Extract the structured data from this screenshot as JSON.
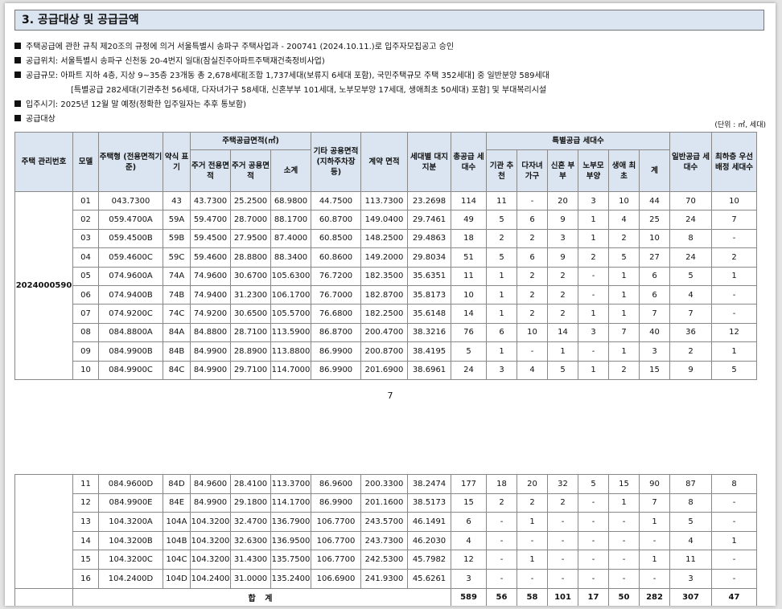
{
  "section_title": "3. 공급대상 및 공급금액",
  "bullets": [
    "주택공급에 관한 규칙 제20조의 규정에 의거 서울특별시 송파구 주택사업과 - 200741 (2024.10.11.)로 입주자모집공고 승인",
    "공급위치: 서울특별시 송파구 신천동 20-4번지 일대(잠실진주아파트주택재건축정비사업)",
    "공급규모: 아파트 지하 4층, 지상 9~35층 23개동 총 2,678세대[조합 1,737세대(보류지 6세대 포함), 국민주택규모 주택 352세대] 중 일반분양 589세대",
    "[특별공급 282세대(기관추천 56세대, 다자녀가구 58세대, 신혼부부 101세대, 노부모부양 17세대, 생애최초 50세대) 포함] 및 부대복리시설",
    "입주시기: 2025년 12월 말 예정(정확한 입주일자는 추후 통보함)",
    "공급대상"
  ],
  "unit_note": "(단위 : ㎡, 세대)",
  "headers": {
    "mgmt_no": "주택 관리번호",
    "model": "모델",
    "type": "주택형 (전용면적기준)",
    "abbr": "약식 표기",
    "supply_area": "주택공급면적(㎡)",
    "exclusive": "주거 전용면적",
    "common": "주거 공용면적",
    "subtotal": "소계",
    "other_common": "기타 공용면적 (지하주차장 등)",
    "contract_area": "계약 면적",
    "land_share": "세대별 대지지분",
    "total_units": "총공급 세대수",
    "special": "특별공급 세대수",
    "inst": "기관 추천",
    "multi": "다자녀 가구",
    "newlywed": "신혼 부부",
    "parents": "노부모 부양",
    "first": "생애 최초",
    "sum": "계",
    "general": "일반공급 세대수",
    "priority": "최하층 우선배정 세대수"
  },
  "management_code": "2024000590",
  "rows_page1": [
    [
      "01",
      "043.7300",
      "43",
      "43.7300",
      "25.2500",
      "68.9800",
      "44.7500",
      "113.7300",
      "23.2698",
      "114",
      "11",
      "-",
      "20",
      "3",
      "10",
      "44",
      "70",
      "10"
    ],
    [
      "02",
      "059.4700A",
      "59A",
      "59.4700",
      "28.7000",
      "88.1700",
      "60.8700",
      "149.0400",
      "29.7461",
      "49",
      "5",
      "6",
      "9",
      "1",
      "4",
      "25",
      "24",
      "7"
    ],
    [
      "03",
      "059.4500B",
      "59B",
      "59.4500",
      "27.9500",
      "87.4000",
      "60.8500",
      "148.2500",
      "29.4863",
      "18",
      "2",
      "2",
      "3",
      "1",
      "2",
      "10",
      "8",
      "-"
    ],
    [
      "04",
      "059.4600C",
      "59C",
      "59.4600",
      "28.8800",
      "88.3400",
      "60.8600",
      "149.2000",
      "29.8034",
      "51",
      "5",
      "6",
      "9",
      "2",
      "5",
      "27",
      "24",
      "2"
    ],
    [
      "05",
      "074.9600A",
      "74A",
      "74.9600",
      "30.6700",
      "105.6300",
      "76.7200",
      "182.3500",
      "35.6351",
      "11",
      "1",
      "2",
      "2",
      "-",
      "1",
      "6",
      "5",
      "1"
    ],
    [
      "06",
      "074.9400B",
      "74B",
      "74.9400",
      "31.2300",
      "106.1700",
      "76.7000",
      "182.8700",
      "35.8173",
      "10",
      "1",
      "2",
      "2",
      "-",
      "1",
      "6",
      "4",
      "-"
    ],
    [
      "07",
      "074.9200C",
      "74C",
      "74.9200",
      "30.6500",
      "105.5700",
      "76.6800",
      "182.2500",
      "35.6148",
      "14",
      "1",
      "2",
      "2",
      "1",
      "1",
      "7",
      "7",
      "-"
    ],
    [
      "08",
      "084.8800A",
      "84A",
      "84.8800",
      "28.7100",
      "113.5900",
      "86.8700",
      "200.4700",
      "38.3216",
      "76",
      "6",
      "10",
      "14",
      "3",
      "7",
      "40",
      "36",
      "12"
    ],
    [
      "09",
      "084.9900B",
      "84B",
      "84.9900",
      "28.8900",
      "113.8800",
      "86.9900",
      "200.8700",
      "38.4195",
      "5",
      "1",
      "-",
      "1",
      "-",
      "1",
      "3",
      "2",
      "1"
    ],
    [
      "10",
      "084.9900C",
      "84C",
      "84.9900",
      "29.7100",
      "114.7000",
      "86.9900",
      "201.6900",
      "38.6961",
      "24",
      "3",
      "4",
      "5",
      "1",
      "2",
      "15",
      "9",
      "5"
    ]
  ],
  "page_number": "7",
  "rows_page2": [
    [
      "11",
      "084.9600D",
      "84D",
      "84.9600",
      "28.4100",
      "113.3700",
      "86.9600",
      "200.3300",
      "38.2474",
      "177",
      "18",
      "20",
      "32",
      "5",
      "15",
      "90",
      "87",
      "8"
    ],
    [
      "12",
      "084.9900E",
      "84E",
      "84.9900",
      "29.1800",
      "114.1700",
      "86.9900",
      "201.1600",
      "38.5173",
      "15",
      "2",
      "2",
      "2",
      "-",
      "1",
      "7",
      "8",
      "-"
    ],
    [
      "13",
      "104.3200A",
      "104A",
      "104.3200",
      "32.4700",
      "136.7900",
      "106.7700",
      "243.5700",
      "46.1491",
      "6",
      "-",
      "1",
      "-",
      "-",
      "-",
      "1",
      "5",
      "-"
    ],
    [
      "14",
      "104.3200B",
      "104B",
      "104.3200",
      "32.6300",
      "136.9500",
      "106.7700",
      "243.7300",
      "46.2030",
      "4",
      "-",
      "-",
      "-",
      "-",
      "-",
      "-",
      "4",
      "1"
    ],
    [
      "15",
      "104.3200C",
      "104C",
      "104.3200",
      "31.4300",
      "135.7500",
      "106.7700",
      "242.5300",
      "45.7982",
      "12",
      "-",
      "1",
      "-",
      "-",
      "-",
      "1",
      "11",
      "-"
    ],
    [
      "16",
      "104.2400D",
      "104D",
      "104.2400",
      "31.0000",
      "135.2400",
      "106.6900",
      "241.9300",
      "45.6261",
      "3",
      "-",
      "-",
      "-",
      "-",
      "-",
      "-",
      "3",
      "-"
    ]
  ],
  "total": {
    "label": "합 계",
    "values": [
      "589",
      "56",
      "58",
      "101",
      "17",
      "50",
      "282",
      "307",
      "47"
    ]
  }
}
